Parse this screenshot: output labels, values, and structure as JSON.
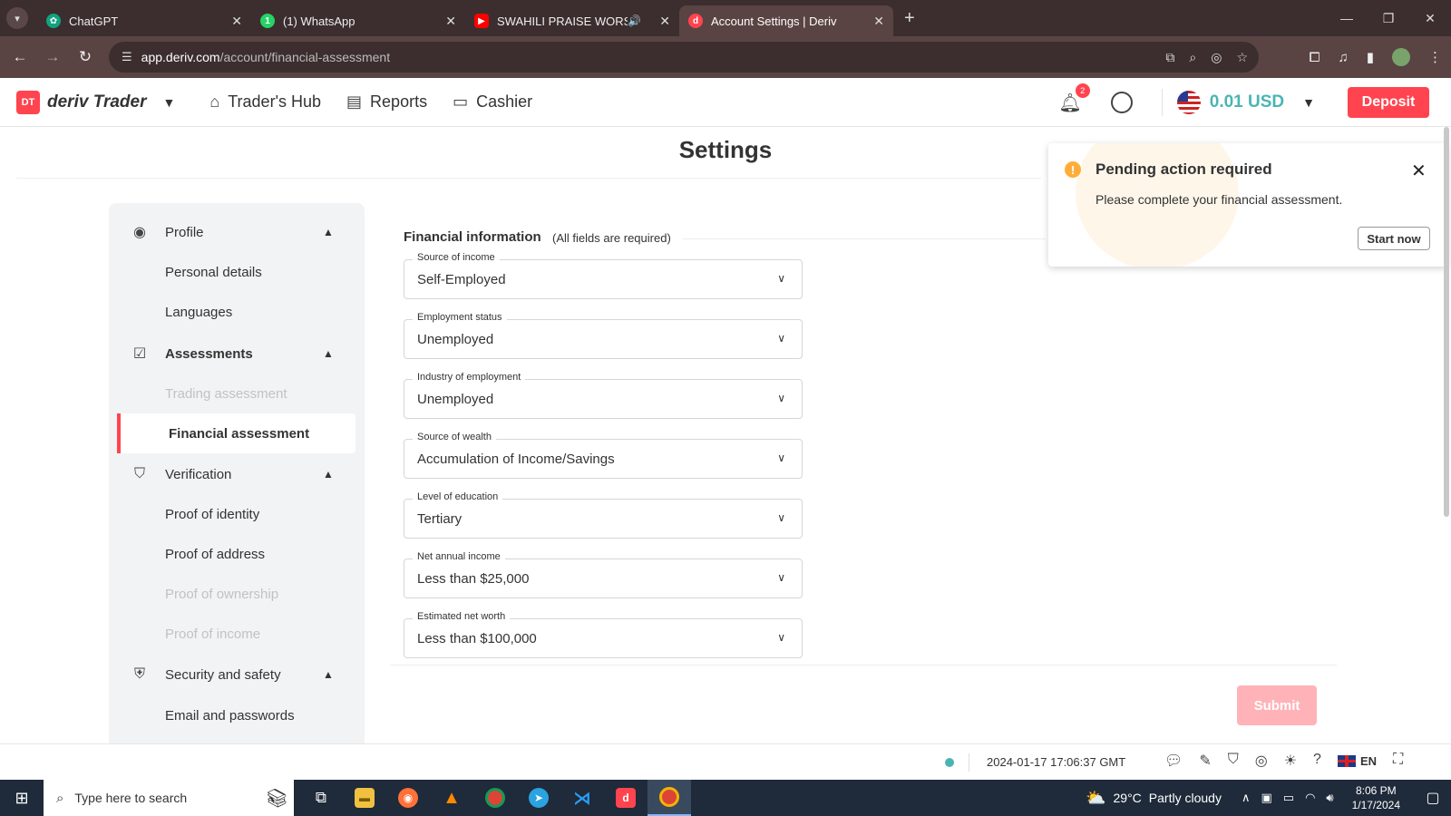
{
  "browser": {
    "tabs": [
      {
        "title": "ChatGPT",
        "favicon_color": "#10a37f",
        "active": false
      },
      {
        "title": "(1) WhatsApp",
        "favicon_color": "#25d366",
        "active": false
      },
      {
        "title": "SWAHILI PRAISE WORSHIP",
        "favicon_color": "#ff0000",
        "active": false,
        "audio": true
      },
      {
        "title": "Account Settings | Deriv",
        "favicon_color": "#ff444f",
        "active": true
      }
    ],
    "url_host": "app.deriv.com",
    "url_path": "/account/financial-assessment"
  },
  "header": {
    "brand_logo": "DT",
    "brand_name": "deriv Trader",
    "nav": [
      {
        "label": "Trader's Hub",
        "icon": "home-icon"
      },
      {
        "label": "Reports",
        "icon": "reports-icon"
      },
      {
        "label": "Cashier",
        "icon": "cashier-icon"
      }
    ],
    "notifications_count": "2",
    "balance": "0.01 USD",
    "deposit_label": "Deposit"
  },
  "page": {
    "title": "Settings"
  },
  "sidebar": {
    "groups": [
      {
        "label": "Profile",
        "icon": "profile-icon",
        "bold": false
      },
      {
        "label": "Assessments",
        "icon": "assessment-icon",
        "bold": true
      },
      {
        "label": "Verification",
        "icon": "verification-icon",
        "bold": false
      },
      {
        "label": "Security and safety",
        "icon": "security-icon",
        "bold": false
      }
    ],
    "items": [
      {
        "label": "Personal details",
        "state": "normal"
      },
      {
        "label": "Languages",
        "state": "normal"
      },
      {
        "label": "Trading assessment",
        "state": "disabled"
      },
      {
        "label": "Financial assessment",
        "state": "active"
      },
      {
        "label": "Proof of identity",
        "state": "normal"
      },
      {
        "label": "Proof of address",
        "state": "normal"
      },
      {
        "label": "Proof of ownership",
        "state": "disabled"
      },
      {
        "label": "Proof of income",
        "state": "disabled"
      },
      {
        "label": "Email and passwords",
        "state": "normal"
      }
    ]
  },
  "form": {
    "section_title": "Financial information",
    "section_note": "(All fields are required)",
    "fields": [
      {
        "label": "Source of income",
        "value": "Self-Employed"
      },
      {
        "label": "Employment status",
        "value": "Unemployed"
      },
      {
        "label": "Industry of employment",
        "value": "Unemployed"
      },
      {
        "label": "Source of wealth",
        "value": "Accumulation of Income/Savings"
      },
      {
        "label": "Level of education",
        "value": "Tertiary"
      },
      {
        "label": "Net annual income",
        "value": "Less than $25,000"
      },
      {
        "label": "Estimated net worth",
        "value": "Less than $100,000"
      }
    ],
    "submit_label": "Submit"
  },
  "toast": {
    "title": "Pending action required",
    "message": "Please complete your financial assessment.",
    "button": "Start now"
  },
  "footer": {
    "server_time": "2024-01-17 17:06:37 GMT",
    "language": "EN",
    "status_color": "#4bb4b3"
  },
  "taskbar": {
    "search_placeholder": "Type here to search",
    "weather_temp": "29°C",
    "weather_desc": "Partly cloudy",
    "time": "8:06 PM",
    "date": "1/17/2024"
  },
  "colors": {
    "brand_red": "#ff444f",
    "balance_teal": "#4bb4b3",
    "warning_orange": "#ffad3a"
  }
}
